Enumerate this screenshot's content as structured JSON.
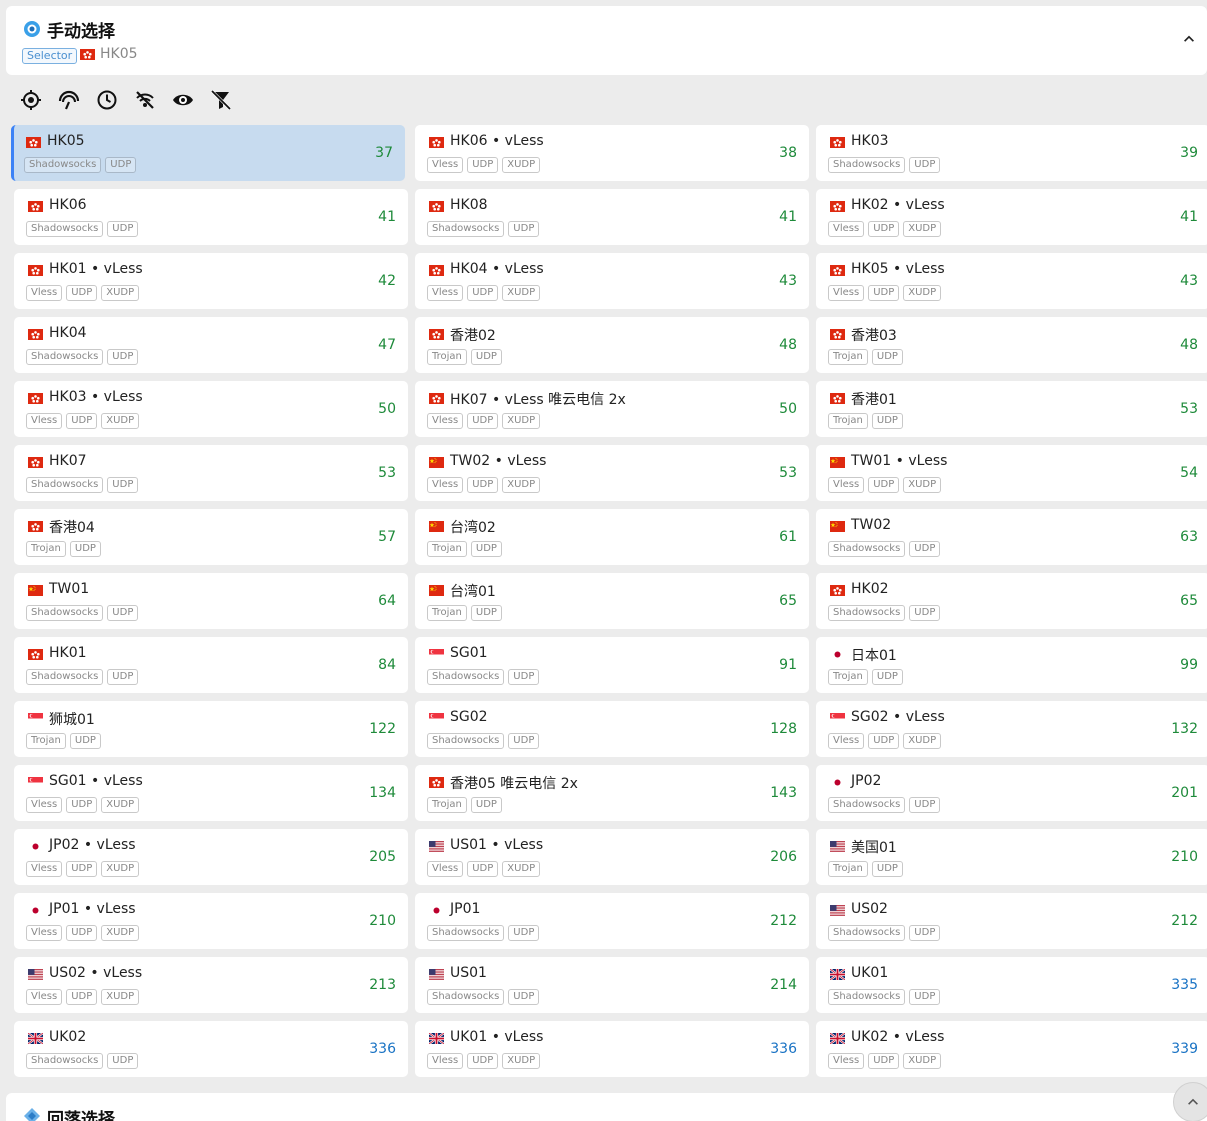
{
  "group": {
    "title": "手动选择",
    "type_badge": "Selector",
    "current": "HK05",
    "current_flag": "hk",
    "toggle": "⌃"
  },
  "toolbar": [
    {
      "name": "locate-icon"
    },
    {
      "name": "speed-test-icon"
    },
    {
      "name": "sort-clock-icon"
    },
    {
      "name": "hide-unavailable-icon"
    },
    {
      "name": "visibility-eye-icon"
    },
    {
      "name": "filter-off-icon"
    }
  ],
  "colors": {
    "latency_fast": "#1e8a3a",
    "latency_slow": "#1a73c4",
    "selected_bg": "#c7dbef",
    "accent": "#3b82f6"
  },
  "proxies": [
    {
      "name": "HK05",
      "flag": "hk",
      "tags": [
        "Shadowsocks",
        "UDP"
      ],
      "latency": "37",
      "level": "green",
      "selected": true
    },
    {
      "name": "HK06 • vLess",
      "flag": "hk",
      "tags": [
        "Vless",
        "UDP",
        "XUDP"
      ],
      "latency": "38",
      "level": "green"
    },
    {
      "name": "HK03",
      "flag": "hk",
      "tags": [
        "Shadowsocks",
        "UDP"
      ],
      "latency": "39",
      "level": "green"
    },
    {
      "name": "HK06",
      "flag": "hk",
      "tags": [
        "Shadowsocks",
        "UDP"
      ],
      "latency": "41",
      "level": "green"
    },
    {
      "name": "HK08",
      "flag": "hk",
      "tags": [
        "Shadowsocks",
        "UDP"
      ],
      "latency": "41",
      "level": "green"
    },
    {
      "name": "HK02 • vLess",
      "flag": "hk",
      "tags": [
        "Vless",
        "UDP",
        "XUDP"
      ],
      "latency": "41",
      "level": "green"
    },
    {
      "name": "HK01 • vLess",
      "flag": "hk",
      "tags": [
        "Vless",
        "UDP",
        "XUDP"
      ],
      "latency": "42",
      "level": "green"
    },
    {
      "name": "HK04 • vLess",
      "flag": "hk",
      "tags": [
        "Vless",
        "UDP",
        "XUDP"
      ],
      "latency": "43",
      "level": "green"
    },
    {
      "name": "HK05 • vLess",
      "flag": "hk",
      "tags": [
        "Vless",
        "UDP",
        "XUDP"
      ],
      "latency": "43",
      "level": "green"
    },
    {
      "name": "HK04",
      "flag": "hk",
      "tags": [
        "Shadowsocks",
        "UDP"
      ],
      "latency": "47",
      "level": "green"
    },
    {
      "name": "香港02",
      "flag": "hk",
      "tags": [
        "Trojan",
        "UDP"
      ],
      "latency": "48",
      "level": "green"
    },
    {
      "name": "香港03",
      "flag": "hk",
      "tags": [
        "Trojan",
        "UDP"
      ],
      "latency": "48",
      "level": "green"
    },
    {
      "name": "HK03 • vLess",
      "flag": "hk",
      "tags": [
        "Vless",
        "UDP",
        "XUDP"
      ],
      "latency": "50",
      "level": "green"
    },
    {
      "name": "HK07 • vLess 唯云电信 2x",
      "flag": "hk",
      "tags": [
        "Vless",
        "UDP",
        "XUDP"
      ],
      "latency": "50",
      "level": "green"
    },
    {
      "name": "香港01",
      "flag": "hk",
      "tags": [
        "Trojan",
        "UDP"
      ],
      "latency": "53",
      "level": "green"
    },
    {
      "name": "HK07",
      "flag": "hk",
      "tags": [
        "Shadowsocks",
        "UDP"
      ],
      "latency": "53",
      "level": "green"
    },
    {
      "name": "TW02 • vLess",
      "flag": "cn",
      "tags": [
        "Vless",
        "UDP",
        "XUDP"
      ],
      "latency": "53",
      "level": "green"
    },
    {
      "name": "TW01 • vLess",
      "flag": "cn",
      "tags": [
        "Vless",
        "UDP",
        "XUDP"
      ],
      "latency": "54",
      "level": "green"
    },
    {
      "name": "香港04",
      "flag": "hk",
      "tags": [
        "Trojan",
        "UDP"
      ],
      "latency": "57",
      "level": "green"
    },
    {
      "name": "台湾02",
      "flag": "cn",
      "tags": [
        "Trojan",
        "UDP"
      ],
      "latency": "61",
      "level": "green"
    },
    {
      "name": "TW02",
      "flag": "cn",
      "tags": [
        "Shadowsocks",
        "UDP"
      ],
      "latency": "63",
      "level": "green"
    },
    {
      "name": "TW01",
      "flag": "cn",
      "tags": [
        "Shadowsocks",
        "UDP"
      ],
      "latency": "64",
      "level": "green"
    },
    {
      "name": "台湾01",
      "flag": "cn",
      "tags": [
        "Trojan",
        "UDP"
      ],
      "latency": "65",
      "level": "green"
    },
    {
      "name": "HK02",
      "flag": "hk",
      "tags": [
        "Shadowsocks",
        "UDP"
      ],
      "latency": "65",
      "level": "green"
    },
    {
      "name": "HK01",
      "flag": "hk",
      "tags": [
        "Shadowsocks",
        "UDP"
      ],
      "latency": "84",
      "level": "green"
    },
    {
      "name": "SG01",
      "flag": "sg",
      "tags": [
        "Shadowsocks",
        "UDP"
      ],
      "latency": "91",
      "level": "green"
    },
    {
      "name": "日本01",
      "flag": "jp",
      "tags": [
        "Trojan",
        "UDP"
      ],
      "latency": "99",
      "level": "green"
    },
    {
      "name": "狮城01",
      "flag": "sg",
      "tags": [
        "Trojan",
        "UDP"
      ],
      "latency": "122",
      "level": "green"
    },
    {
      "name": "SG02",
      "flag": "sg",
      "tags": [
        "Shadowsocks",
        "UDP"
      ],
      "latency": "128",
      "level": "green"
    },
    {
      "name": "SG02 • vLess",
      "flag": "sg",
      "tags": [
        "Vless",
        "UDP",
        "XUDP"
      ],
      "latency": "132",
      "level": "green"
    },
    {
      "name": "SG01 • vLess",
      "flag": "sg",
      "tags": [
        "Vless",
        "UDP",
        "XUDP"
      ],
      "latency": "134",
      "level": "green"
    },
    {
      "name": "香港05 唯云电信 2x",
      "flag": "hk",
      "tags": [
        "Trojan",
        "UDP"
      ],
      "latency": "143",
      "level": "green"
    },
    {
      "name": "JP02",
      "flag": "jp",
      "tags": [
        "Shadowsocks",
        "UDP"
      ],
      "latency": "201",
      "level": "green"
    },
    {
      "name": "JP02 • vLess",
      "flag": "jp",
      "tags": [
        "Vless",
        "UDP",
        "XUDP"
      ],
      "latency": "205",
      "level": "green"
    },
    {
      "name": "US01 • vLess",
      "flag": "us",
      "tags": [
        "Vless",
        "UDP",
        "XUDP"
      ],
      "latency": "206",
      "level": "green"
    },
    {
      "name": "美国01",
      "flag": "us",
      "tags": [
        "Trojan",
        "UDP"
      ],
      "latency": "210",
      "level": "green"
    },
    {
      "name": "JP01 • vLess",
      "flag": "jp",
      "tags": [
        "Vless",
        "UDP",
        "XUDP"
      ],
      "latency": "210",
      "level": "green"
    },
    {
      "name": "JP01",
      "flag": "jp",
      "tags": [
        "Shadowsocks",
        "UDP"
      ],
      "latency": "212",
      "level": "green"
    },
    {
      "name": "US02",
      "flag": "us",
      "tags": [
        "Shadowsocks",
        "UDP"
      ],
      "latency": "212",
      "level": "green"
    },
    {
      "name": "US02 • vLess",
      "flag": "us",
      "tags": [
        "Vless",
        "UDP",
        "XUDP"
      ],
      "latency": "213",
      "level": "green"
    },
    {
      "name": "US01",
      "flag": "us",
      "tags": [
        "Shadowsocks",
        "UDP"
      ],
      "latency": "214",
      "level": "green"
    },
    {
      "name": "UK01",
      "flag": "uk",
      "tags": [
        "Shadowsocks",
        "UDP"
      ],
      "latency": "335",
      "level": "blue"
    },
    {
      "name": "UK02",
      "flag": "uk",
      "tags": [
        "Shadowsocks",
        "UDP"
      ],
      "latency": "336",
      "level": "blue"
    },
    {
      "name": "UK01 • vLess",
      "flag": "uk",
      "tags": [
        "Vless",
        "UDP",
        "XUDP"
      ],
      "latency": "336",
      "level": "blue"
    },
    {
      "name": "UK02 • vLess",
      "flag": "uk",
      "tags": [
        "Vless",
        "UDP",
        "XUDP"
      ],
      "latency": "339",
      "level": "blue"
    }
  ],
  "group2": {
    "title": "回落选择"
  },
  "scroll_top": "⌃"
}
